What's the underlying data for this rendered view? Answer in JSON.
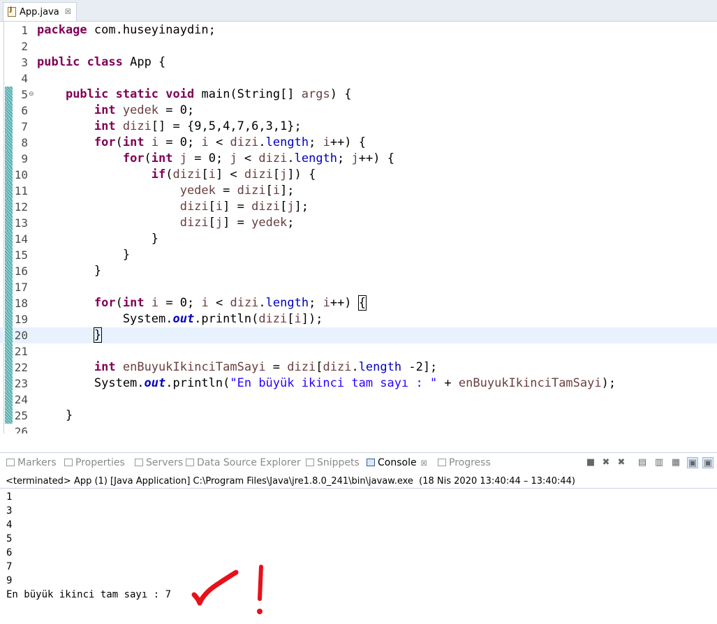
{
  "editor_tab": {
    "label": "App.java",
    "close": "☒"
  },
  "code_lines": [
    {
      "n": "1",
      "html": "<span class=\"k\">package</span> com.huseyinaydin;"
    },
    {
      "n": "2",
      "html": ""
    },
    {
      "n": "3",
      "html": "<span class=\"k\">public</span> <span class=\"k\">class</span> App {"
    },
    {
      "n": "4",
      "html": ""
    },
    {
      "n": "5",
      "html": "    <span class=\"k\">public</span> <span class=\"k\">static</span> <span class=\"k\">void</span> main(String[] <span class=\"v\">args</span>) {",
      "fold": "⊖"
    },
    {
      "n": "6",
      "html": "        <span class=\"k\">int</span> <span class=\"v\">yedek</span> = 0;"
    },
    {
      "n": "7",
      "html": "        <span class=\"k\">int</span> <span class=\"v\">dizi</span>[] = {9,5,4,7,6,3,1};"
    },
    {
      "n": "8",
      "html": "        <span class=\"k\">for</span>(<span class=\"k\">int</span> <span class=\"v\">i</span> = 0; <span class=\"v\">i</span> &lt; <span class=\"v\">dizi</span>.<span class=\"f\">length</span>; <span class=\"v\">i</span>++) {"
    },
    {
      "n": "9",
      "html": "            <span class=\"k\">for</span>(<span class=\"k\">int</span> <span class=\"v\">j</span> = 0; <span class=\"v\">j</span> &lt; <span class=\"v\">dizi</span>.<span class=\"f\">length</span>; <span class=\"v\">j</span>++) {"
    },
    {
      "n": "10",
      "html": "                <span class=\"k\">if</span>(<span class=\"v\">dizi</span>[<span class=\"v\">i</span>] &lt; <span class=\"v\">dizi</span>[<span class=\"v\">j</span>]) {"
    },
    {
      "n": "11",
      "html": "                    <span class=\"v\">yedek</span> = <span class=\"v\">dizi</span>[<span class=\"v\">i</span>];"
    },
    {
      "n": "12",
      "html": "                    <span class=\"v\">dizi</span>[<span class=\"v\">i</span>] = <span class=\"v\">dizi</span>[<span class=\"v\">j</span>];"
    },
    {
      "n": "13",
      "html": "                    <span class=\"v\">dizi</span>[<span class=\"v\">j</span>] = <span class=\"v\">yedek</span>;"
    },
    {
      "n": "14",
      "html": "                }"
    },
    {
      "n": "15",
      "html": "            }"
    },
    {
      "n": "16",
      "html": "        }"
    },
    {
      "n": "17",
      "html": ""
    },
    {
      "n": "18",
      "html": "        <span class=\"k\">for</span>(<span class=\"k\">int</span> <span class=\"v\">i</span> = 0; <span class=\"v\">i</span> &lt; <span class=\"v\">dizi</span>.<span class=\"f\">length</span>; <span class=\"v\">i</span>++) <span class=\"bm\">{</span>"
    },
    {
      "n": "19",
      "html": "            System.<span class=\"sf\">out</span>.println(<span class=\"v\">dizi</span>[<span class=\"v\">i</span>]);"
    },
    {
      "n": "20",
      "html": "        <span class=\"bm\">}</span><span class=\"caret\"></span>",
      "current": true
    },
    {
      "n": "21",
      "html": ""
    },
    {
      "n": "22",
      "html": "        <span class=\"k\">int</span> <span class=\"v\">enBuyukIkinciTamSayi</span> = <span class=\"v\">dizi</span>[<span class=\"v\">dizi</span>.<span class=\"f\">length</span> -2];"
    },
    {
      "n": "23",
      "html": "        System.<span class=\"sf\">out</span>.println(<span class=\"s\">\"En büyük ikinci tam sayı : \"</span> + <span class=\"v\">enBuyukIkinciTamSayi</span>);"
    },
    {
      "n": "24",
      "html": ""
    },
    {
      "n": "25",
      "html": "    }"
    },
    {
      "n": "26",
      "html": ""
    }
  ],
  "view_tabs": [
    {
      "label": "Markers",
      "active": false
    },
    {
      "label": "Properties",
      "active": false
    },
    {
      "label": "Servers",
      "active": false
    },
    {
      "label": "Data Source Explorer",
      "active": false
    },
    {
      "label": "Snippets",
      "active": false
    },
    {
      "label": "Console",
      "active": true
    },
    {
      "label": "Progress",
      "active": false
    }
  ],
  "console": {
    "status": "<terminated> App (1) [Java Application] C:\\Program Files\\Java\\jre1.8.0_241\\bin\\javaw.exe  (18 Nis 2020 13:40:44 – 13:40:44)",
    "output": [
      "1",
      "3",
      "4",
      "5",
      "6",
      "7",
      "9",
      "En büyük ikinci tam sayı : 7"
    ]
  },
  "colors": {
    "annotation": "#e8101a",
    "keyword": "#7f0055",
    "string": "#2a00ff"
  }
}
